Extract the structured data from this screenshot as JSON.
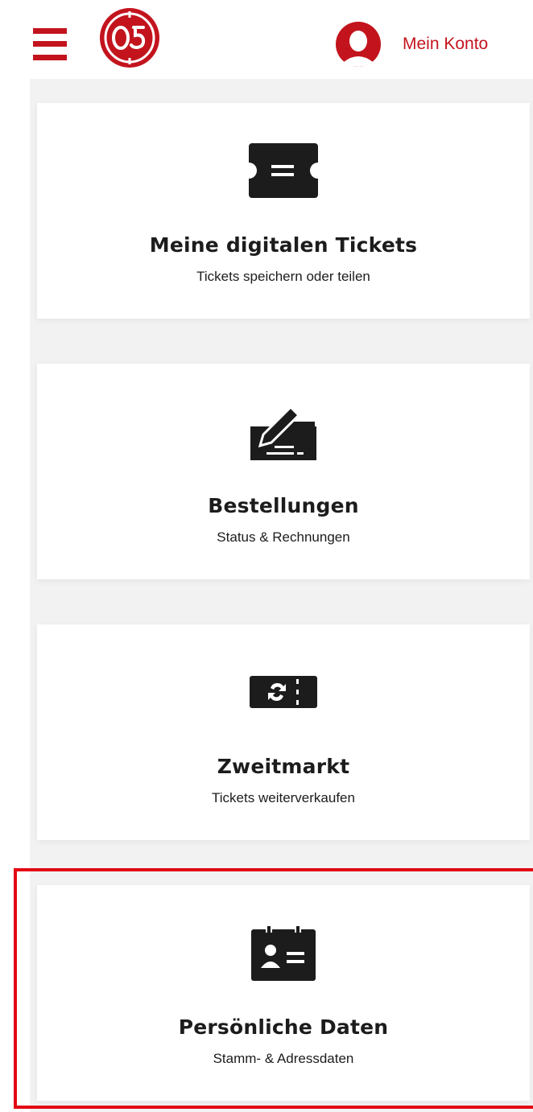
{
  "header": {
    "menu_icon": "hamburger-menu-icon",
    "logo_icon": "mainz-05-logo",
    "account_icon": "user-avatar-icon",
    "account_label": "Mein Konto"
  },
  "colors": {
    "brand_red": "#c3141e",
    "highlight_red": "#e30613",
    "icon_dark": "#1c1c1c",
    "background": "#f2f2f2"
  },
  "cards": [
    {
      "icon": "ticket-icon",
      "title": "Meine digitalen Tickets",
      "subtitle": "Tickets speichern oder teilen"
    },
    {
      "icon": "signature-icon",
      "title": "Bestellungen",
      "subtitle": "Status & Rechnungen"
    },
    {
      "icon": "ticket-resale-icon",
      "title": "Zweitmarkt",
      "subtitle": "Tickets weiterverkaufen"
    },
    {
      "icon": "id-card-icon",
      "title": "Persönliche Daten",
      "subtitle": "Stamm- & Adressdaten"
    }
  ]
}
